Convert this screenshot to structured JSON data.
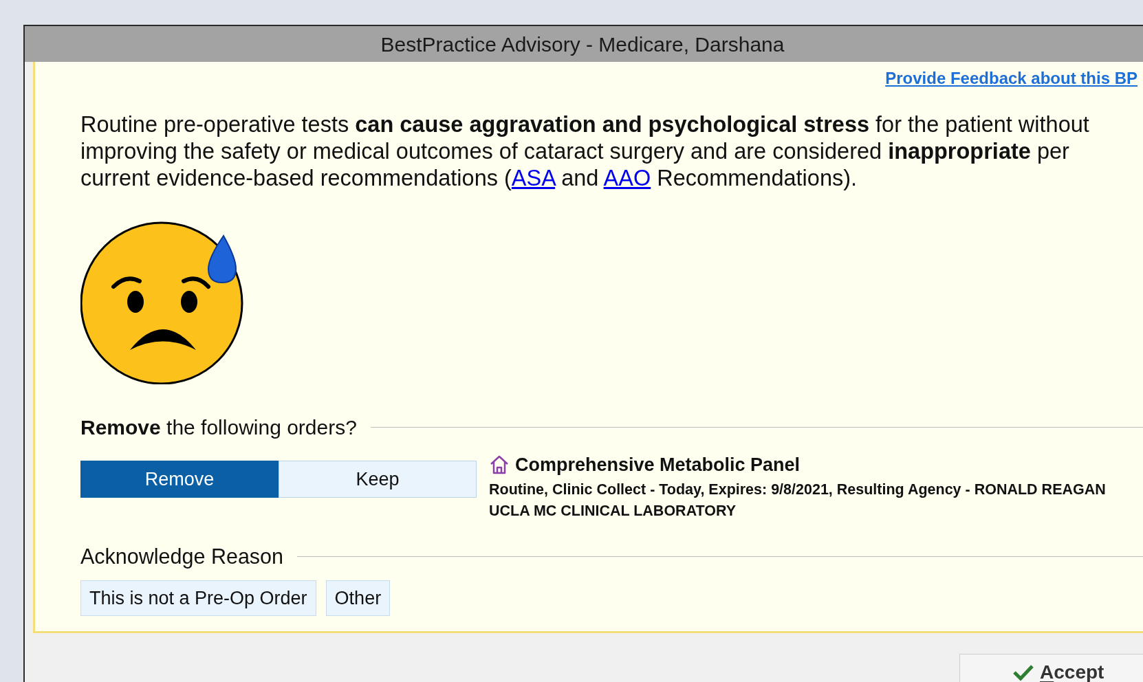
{
  "window": {
    "title": "BestPractice Advisory - Medicare, Darshana"
  },
  "feedback_link": "Provide Feedback about this BP",
  "message": [
    {
      "kind": "text",
      "text": "Routine pre-operative tests "
    },
    {
      "kind": "bold",
      "text": "can cause aggravation and psychological stress"
    },
    {
      "kind": "text",
      "text": " for the patient without improving the safety or medical outcomes of cataract surgery and are considered "
    },
    {
      "kind": "bold",
      "text": "inappropriate"
    },
    {
      "kind": "text",
      "text": " per current evidence-based recommendations ("
    },
    {
      "kind": "link",
      "text": "ASA"
    },
    {
      "kind": "text",
      "text": " and "
    },
    {
      "kind": "link",
      "text": "AAO"
    },
    {
      "kind": "text",
      "text": " Recommendations)."
    }
  ],
  "orders": {
    "heading": "**Remove** the following orders?",
    "choices": [
      {
        "label": "Remove",
        "selected": true
      },
      {
        "label": "Keep",
        "selected": false
      }
    ],
    "order": {
      "name": "Comprehensive Metabolic Panel",
      "details": [
        "Routine, Clinic Collect - Today, Expires: 9/8/2021, Resulting Agency - RONALD REAGAN",
        "UCLA MC CLINICAL LABORATORY"
      ]
    }
  },
  "acknowledge": {
    "heading": "Acknowledge Reason",
    "reasons": [
      {
        "label": "This is not a Pre-Op Order",
        "selected": false
      },
      {
        "label": "Other",
        "selected": false
      }
    ]
  },
  "accept_button": "Accept"
}
